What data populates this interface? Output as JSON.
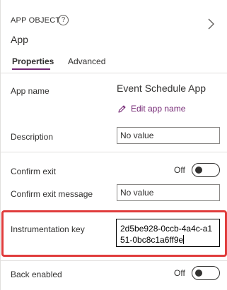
{
  "header": {
    "object_type": "APP OBJECT",
    "help_icon": "question-circle-icon",
    "object_name": "App",
    "collapse_icon": "chevron-right-icon"
  },
  "tabs": [
    {
      "label": "Properties",
      "selected": true
    },
    {
      "label": "Advanced",
      "selected": false
    }
  ],
  "properties": {
    "app_name": {
      "label": "App name",
      "value": "Event Schedule App",
      "edit_label": "Edit app name",
      "edit_icon": "pencil-icon"
    },
    "description": {
      "label": "Description",
      "placeholder": "No value"
    },
    "confirm_exit": {
      "label": "Confirm exit",
      "state": "Off"
    },
    "confirm_exit_message": {
      "label": "Confirm exit message",
      "placeholder": "No value"
    },
    "instrumentation_key": {
      "label": "Instrumentation key",
      "value": "2d5be928-0ccb-4a4c-a151-0bc8c1a6ff9e"
    },
    "back_enabled": {
      "label": "Back enabled",
      "state": "Off"
    }
  },
  "colors": {
    "accent": "#742774",
    "highlight": "#e03c3c",
    "divider": "#e1dfdd",
    "text": "#323130"
  }
}
